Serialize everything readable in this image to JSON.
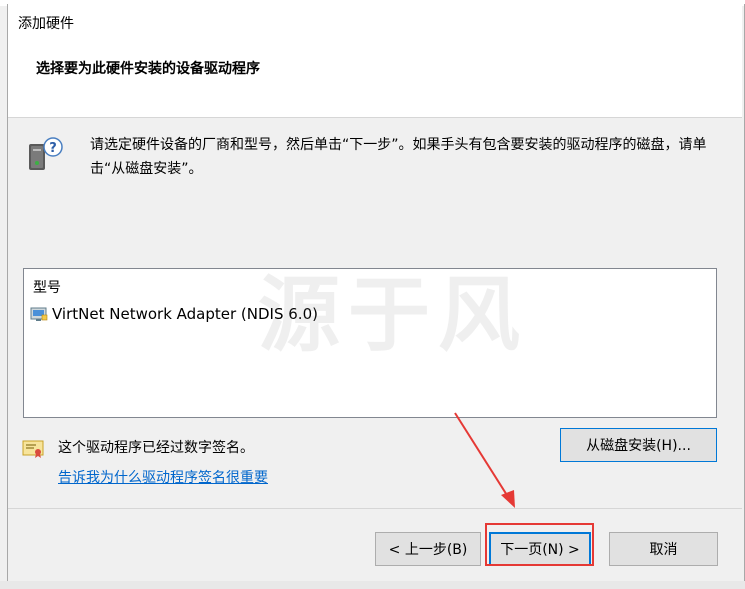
{
  "window": {
    "title": "添加硬件",
    "subtitle": "选择要为此硬件安装的设备驱动程序",
    "instruction": "请选定硬件设备的厂商和型号，然后单击“下一步”。如果手头有包含要安装的驱动程序的磁盘，请单击“从磁盘安装”。"
  },
  "model_list": {
    "header": "型号",
    "items": [
      {
        "label": "VirtNet Network Adapter (NDIS 6.0)",
        "icon": "network-adapter-icon"
      }
    ]
  },
  "watermark": "源于风",
  "signature": {
    "text": "这个驱动程序已经过数字签名。",
    "link": "告诉我为什么驱动程序签名很重要",
    "icon": "certificate-icon"
  },
  "buttons": {
    "have_disk": "从磁盘安装(H)...",
    "back": "< 上一步(B)",
    "next": "下一页(N) >",
    "cancel": "取消"
  },
  "colors": {
    "accent": "#0078d7",
    "link": "#0066cc",
    "annotation": "#e53935"
  }
}
